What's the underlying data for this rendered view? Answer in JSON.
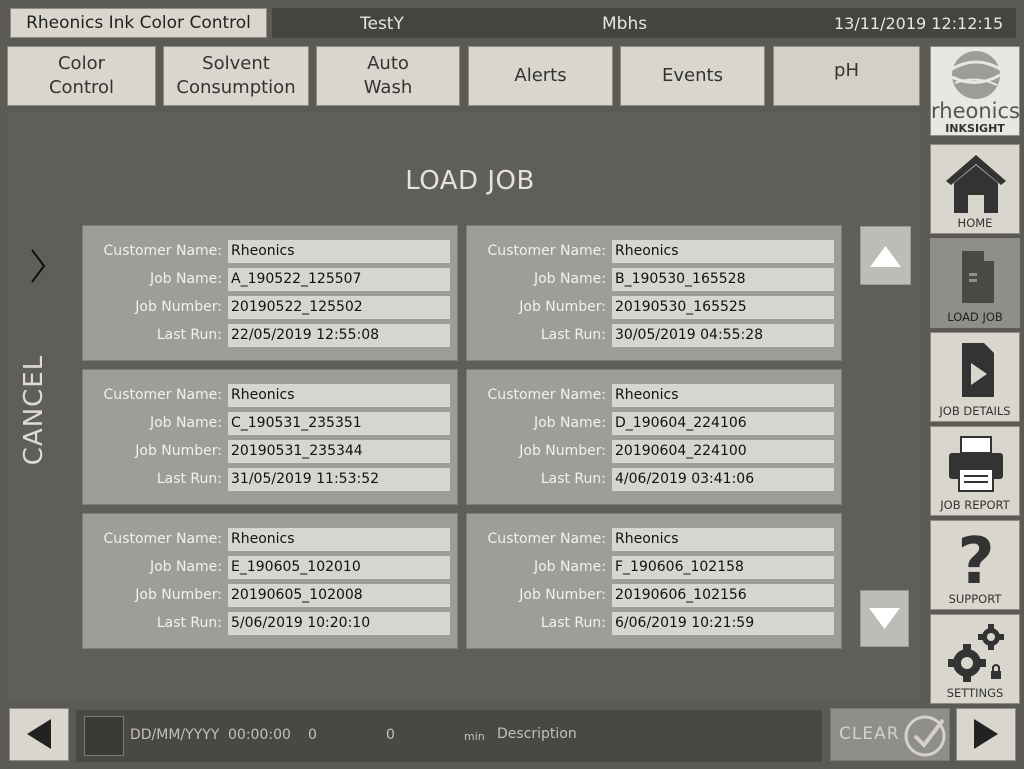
{
  "header": {
    "app_title": "Rheonics Ink Color Control",
    "machine": "TestY",
    "unit": "Mbhs",
    "datetime": "13/11/2019 12:12:15"
  },
  "tabs": [
    {
      "label": "Color\nControl"
    },
    {
      "label": "Solvent\nConsumption"
    },
    {
      "label": "Auto\nWash"
    },
    {
      "label": "Alerts"
    },
    {
      "label": "Events"
    },
    {
      "label": "pH"
    }
  ],
  "page": {
    "title": "LOAD JOB",
    "cancel_label": "CANCEL"
  },
  "field_labels": {
    "customer": "Customer Name:",
    "job_name": "Job Name:",
    "job_number": "Job Number:",
    "last_run": "Last Run:"
  },
  "jobs": [
    {
      "customer": "Rheonics",
      "job_name": "A_190522_125507",
      "job_number": "20190522_125502",
      "last_run": "22/05/2019 12:55:08"
    },
    {
      "customer": "Rheonics",
      "job_name": "B_190530_165528",
      "job_number": "20190530_165525",
      "last_run": "30/05/2019 04:55:28"
    },
    {
      "customer": "Rheonics",
      "job_name": "C_190531_235351",
      "job_number": "20190531_235344",
      "last_run": "31/05/2019 11:53:52"
    },
    {
      "customer": "Rheonics",
      "job_name": "D_190604_224106",
      "job_number": "20190604_224100",
      "last_run": "4/06/2019 03:41:06"
    },
    {
      "customer": "Rheonics",
      "job_name": "E_190605_102010",
      "job_number": "20190605_102008",
      "last_run": "5/06/2019 10:20:10"
    },
    {
      "customer": "Rheonics",
      "job_name": "F_190606_102158",
      "job_number": "20190606_102156",
      "last_run": "6/06/2019 10:21:59"
    }
  ],
  "brand": {
    "name": "rheonics",
    "product": "INKSIGHT"
  },
  "sidebar": [
    {
      "label": "HOME",
      "icon": "home-icon"
    },
    {
      "label": "LOAD JOB",
      "icon": "document-icon"
    },
    {
      "label": "JOB DETAILS",
      "icon": "play-document-icon"
    },
    {
      "label": "JOB REPORT",
      "icon": "printer-icon"
    },
    {
      "label": "SUPPORT",
      "icon": "question-icon"
    },
    {
      "label": "SETTINGS",
      "icon": "gear-lock-icon"
    }
  ],
  "footer": {
    "date": "DD/MM/YYYY",
    "time": "00:00:00",
    "value1": "0",
    "value2": "0",
    "unit": "min",
    "description": "Description",
    "clear_label": "CLEAR"
  },
  "colors": {
    "background": "#5b5a55",
    "button": "#d9d7cd",
    "card": "#9e9d98",
    "field": "#d6d5d0"
  }
}
